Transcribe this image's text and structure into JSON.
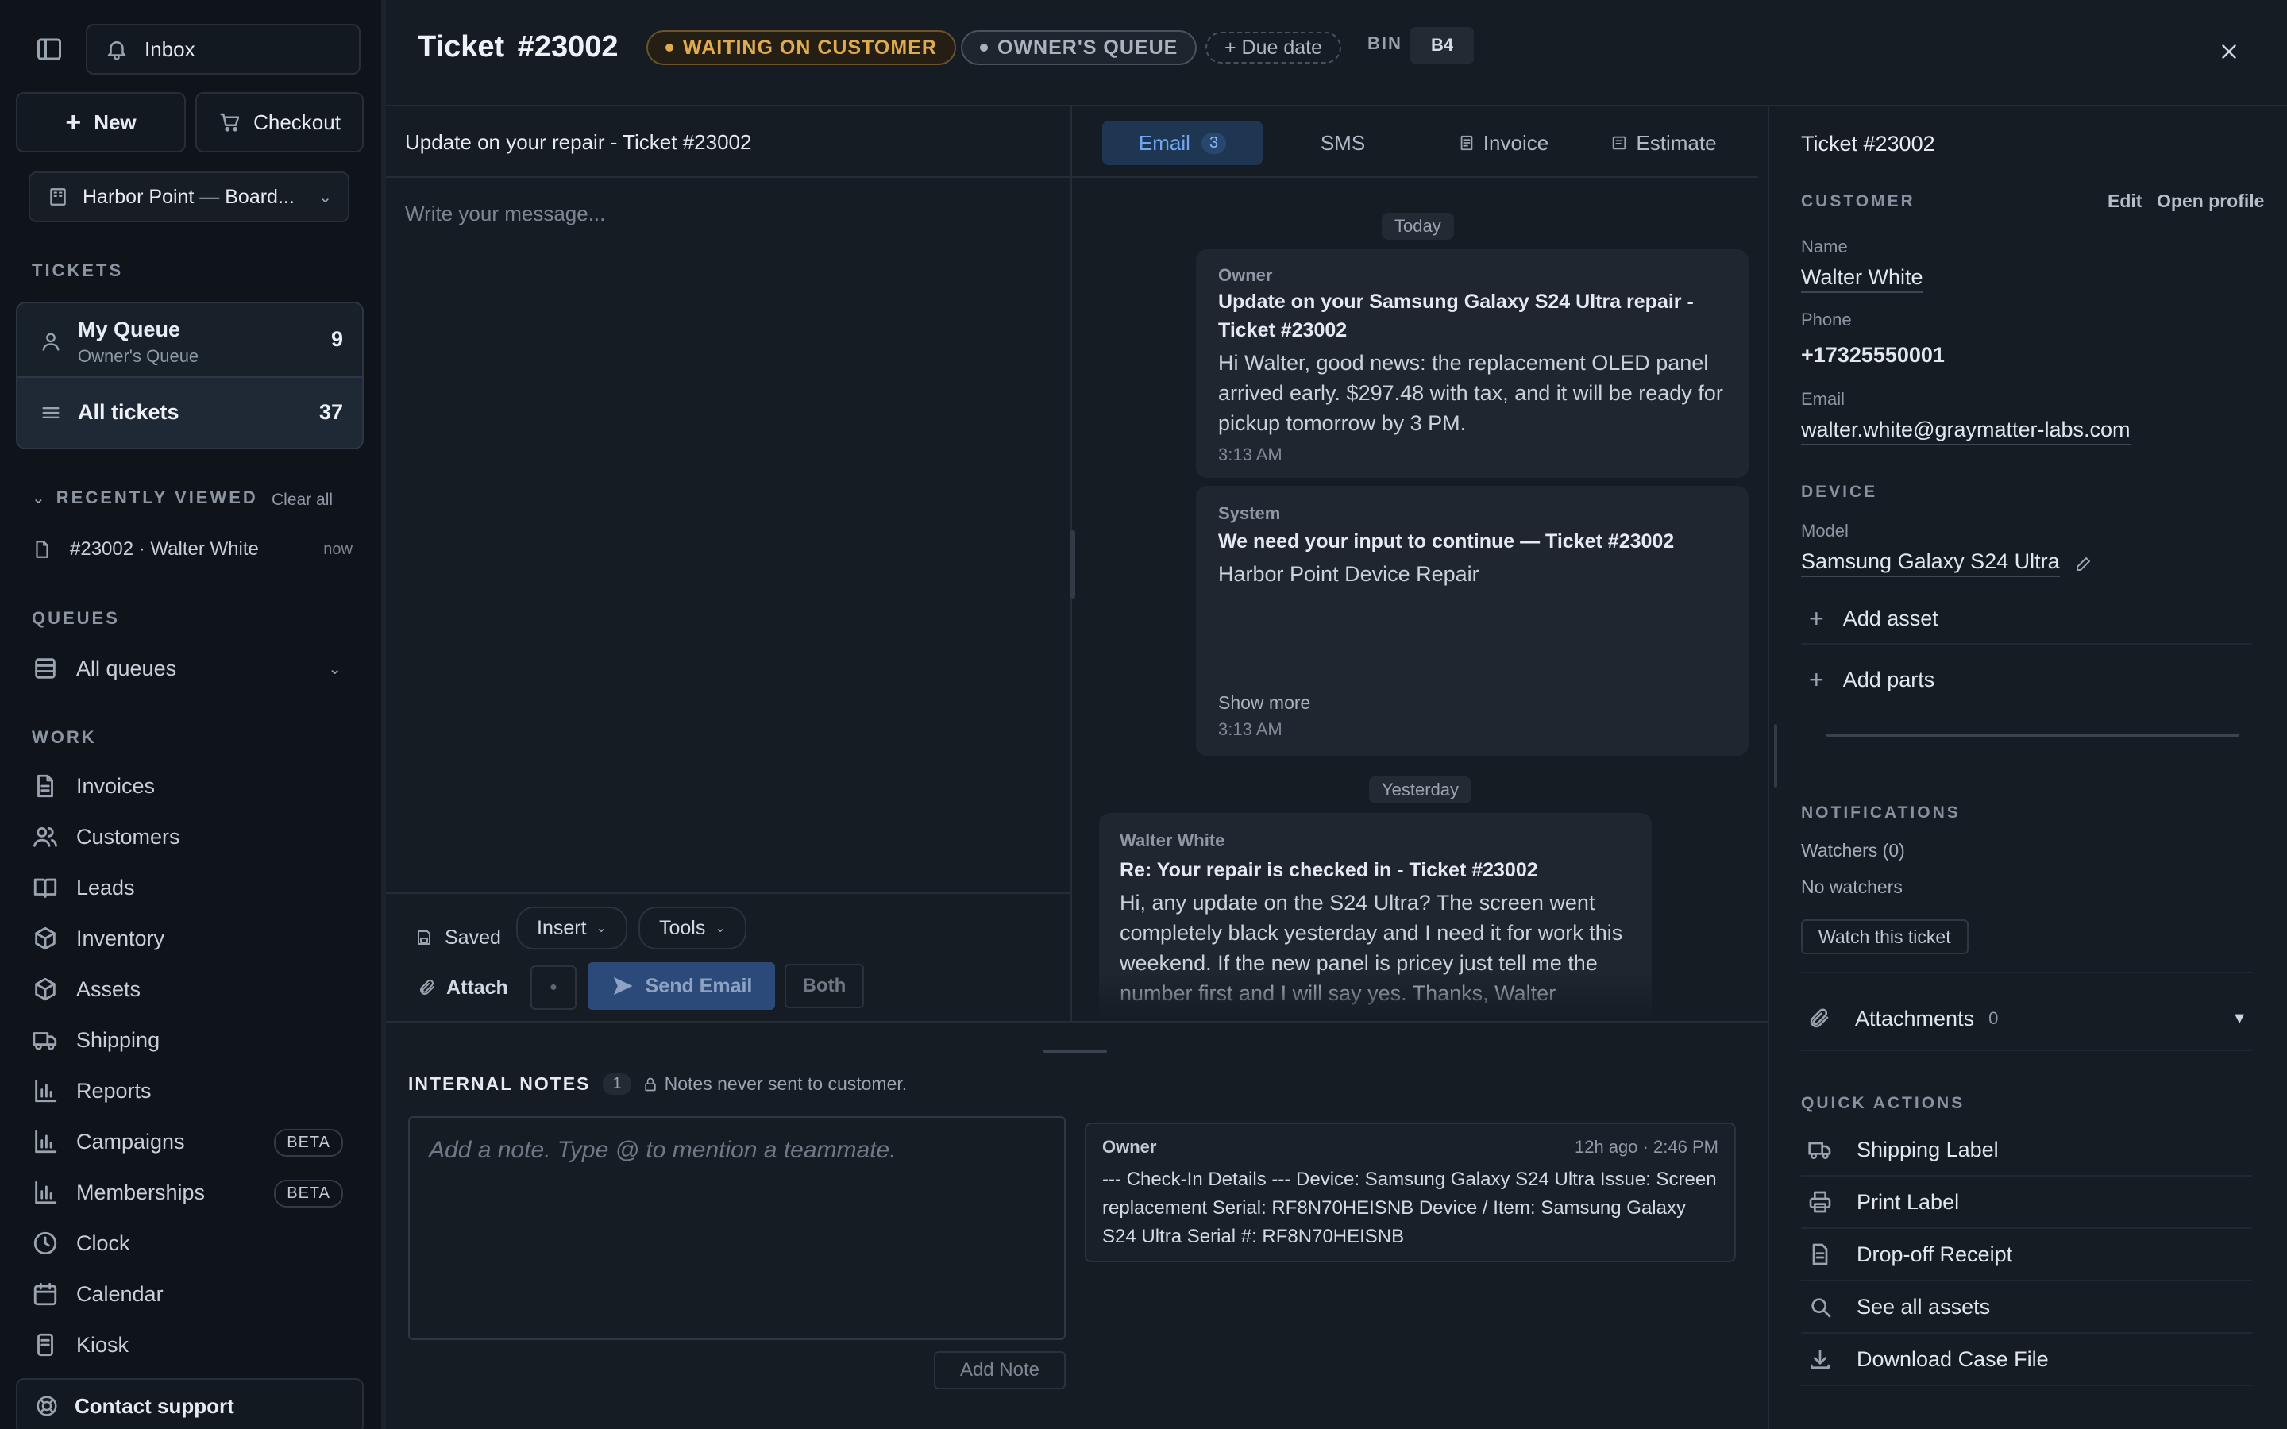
{
  "sidebar": {
    "inbox_label": "Inbox",
    "new_label": "New",
    "checkout_label": "Checkout",
    "location": "Harbor Point — Board...",
    "tickets_section": "TICKETS",
    "my_queue": {
      "title": "My Queue",
      "subtitle": "Owner's Queue",
      "count": "9"
    },
    "all_tickets": {
      "title": "All tickets",
      "count": "37"
    },
    "recently_viewed": {
      "title": "RECENTLY VIEWED",
      "clear": "Clear all",
      "item": "#23002 · Walter White",
      "time": "now"
    },
    "queues_section": "QUEUES",
    "all_queues": "All queues",
    "work_section": "WORK",
    "nav": [
      {
        "label": "Invoices",
        "icon": "file-icon"
      },
      {
        "label": "Customers",
        "icon": "users-icon"
      },
      {
        "label": "Leads",
        "icon": "book-icon"
      },
      {
        "label": "Inventory",
        "icon": "box-icon"
      },
      {
        "label": "Assets",
        "icon": "cube-icon"
      },
      {
        "label": "Shipping",
        "icon": "truck-icon"
      },
      {
        "label": "Reports",
        "icon": "bar-chart-icon"
      },
      {
        "label": "Campaigns",
        "icon": "bar-chart-icon",
        "badge": "BETA"
      },
      {
        "label": "Memberships",
        "icon": "bar-chart-icon",
        "badge": "BETA"
      },
      {
        "label": "Clock",
        "icon": "clock-icon"
      },
      {
        "label": "Calendar",
        "icon": "calendar-icon"
      },
      {
        "label": "Kiosk",
        "icon": "tablet-icon"
      }
    ],
    "contact_support": "Contact support"
  },
  "header": {
    "title": "Ticket #23002",
    "status": "WAITING ON CUSTOMER",
    "queue": "OWNER'S QUEUE",
    "due_date": "+ Due date",
    "bin_label": "BIN",
    "bin_value": "B4",
    "colors": {
      "status": "#d9a54a",
      "queue": "#a9b2bd"
    }
  },
  "composer": {
    "subject": "Update on your repair - Ticket #23002",
    "placeholder": "Write your message...",
    "saved": "Saved",
    "insert": "Insert",
    "tools": "Tools",
    "attach": "Attach",
    "send": "Send Email",
    "both": "Both"
  },
  "tabs": {
    "email": "Email",
    "email_count": "3",
    "sms": "SMS",
    "invoice": "Invoice",
    "estimate": "Estimate"
  },
  "thread": {
    "today": "Today",
    "yesterday": "Yesterday",
    "messages": [
      {
        "sender": "Owner",
        "subject": "Update on your Samsung Galaxy S24 Ultra repair - Ticket #23002",
        "body": "Hi Walter, good news: the replacement OLED panel arrived early. $297.48 with tax, and it will be ready for pickup tomorrow by 3 PM.",
        "time": "3:13 AM"
      },
      {
        "sender": "System",
        "subject": "We need your input to continue — Ticket #23002",
        "body": "Harbor Point Device Repair",
        "show_more": "Show more",
        "time": "3:13 AM"
      },
      {
        "sender": "Walter White",
        "subject": "Re: Your repair is checked in - Ticket #23002",
        "body": "Hi, any update on the S24 Ultra? The screen went completely black yesterday and I need it for work this weekend. If the new panel is pricey just tell me the number first and I will say yes. Thanks, Walter"
      }
    ]
  },
  "notes": {
    "title": "INTERNAL NOTES",
    "count": "1",
    "hint": "Notes never sent to customer.",
    "placeholder": "Add a note. Type @ to mention a teammate.",
    "add_button": "Add Note",
    "items": [
      {
        "author": "Owner",
        "time": "12h ago · 2:46 PM",
        "text": "--- Check-In Details --- Device: Samsung Galaxy S24 Ultra Issue: Screen replacement Serial: RF8N70HEISNB Device / Item: Samsung Galaxy S24 Ultra Serial #: RF8N70HEISNB"
      }
    ]
  },
  "right_panel": {
    "ticket": "Ticket #23002",
    "customer_section": "CUSTOMER",
    "edit": "Edit",
    "open_profile": "Open profile",
    "name_label": "Name",
    "name": "Walter White",
    "phone_label": "Phone",
    "phone": "+17325550001",
    "email_label": "Email",
    "email": "walter.white@graymatter-labs.com",
    "device_section": "DEVICE",
    "model_label": "Model",
    "model": "Samsung Galaxy S24 Ultra",
    "add_asset": "Add asset",
    "add_parts": "Add parts",
    "notifications_section": "NOTIFICATIONS",
    "watchers": "Watchers (0)",
    "no_watchers": "No watchers",
    "watch_button": "Watch this ticket",
    "attachments": "Attachments",
    "attachments_count": "0",
    "quick_actions_section": "QUICK ACTIONS",
    "quick_actions": [
      {
        "label": "Shipping Label",
        "icon": "truck-icon"
      },
      {
        "label": "Print Label",
        "icon": "printer-icon"
      },
      {
        "label": "Drop-off Receipt",
        "icon": "receipt-icon"
      },
      {
        "label": "See all assets",
        "icon": "search-icon"
      },
      {
        "label": "Download Case File",
        "icon": "download-icon"
      }
    ]
  }
}
